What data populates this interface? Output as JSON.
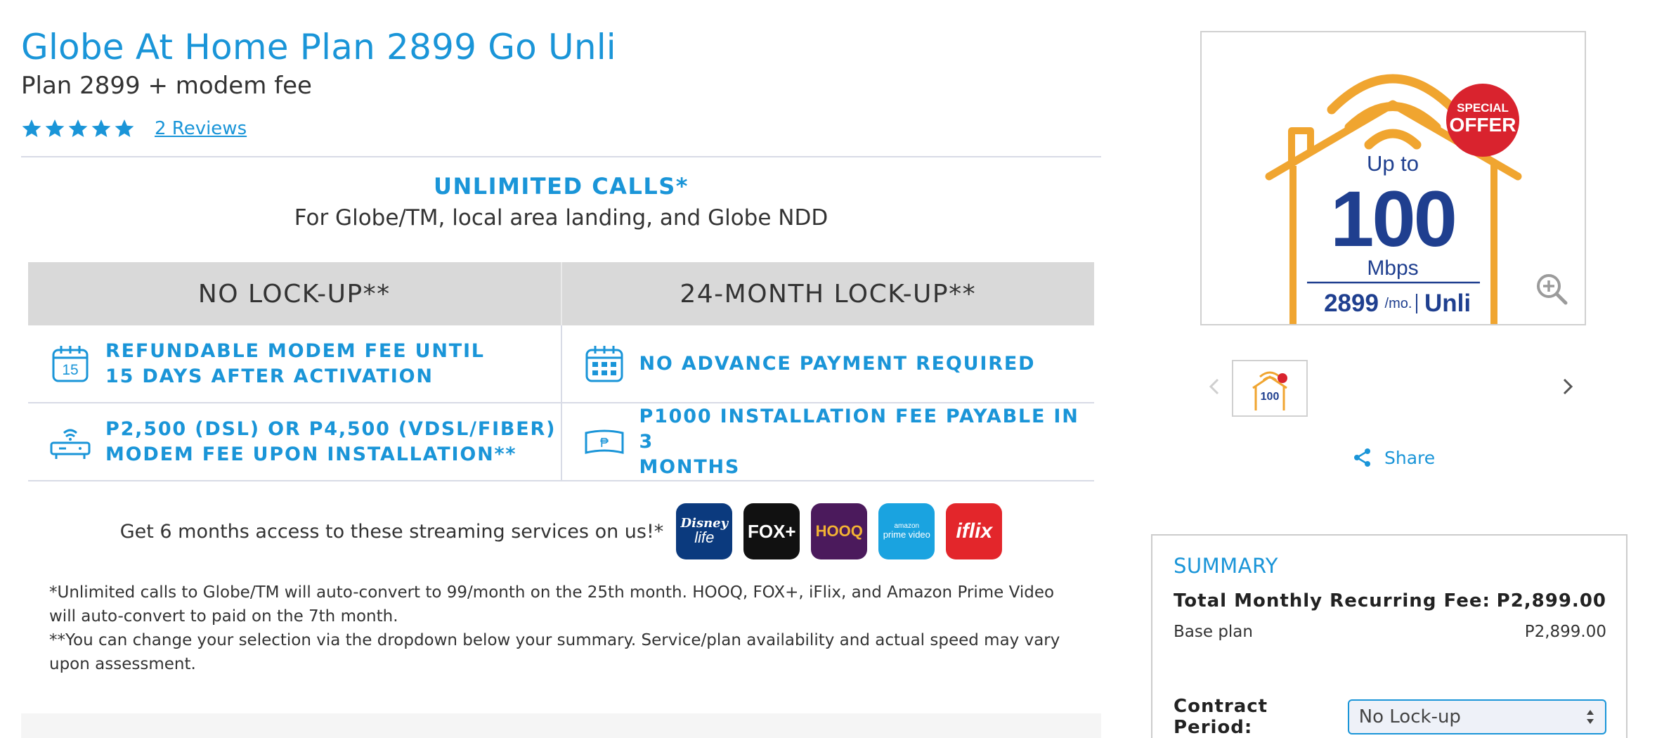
{
  "product": {
    "title": "Globe At Home Plan 2899 Go Unli",
    "subtitle": "Plan 2899 + modem fee",
    "rating_stars": 5,
    "reviews_label": "2 Reviews"
  },
  "calls": {
    "title": "UNLIMITED CALLS*",
    "subtitle": "For Globe/TM, local area landing, and Globe NDD"
  },
  "lockup_table": {
    "headers": [
      "NO LOCK-UP**",
      "24-MONTH LOCK-UP**"
    ],
    "rows": [
      [
        {
          "icon": "calendar-15-icon",
          "text": "REFUNDABLE MODEM FEE UNTIL\n15 DAYS AFTER ACTIVATION"
        },
        {
          "icon": "calendar-grid-icon",
          "text": "NO ADVANCE PAYMENT REQUIRED"
        }
      ],
      [
        {
          "icon": "modem-router-icon",
          "text": "P2,500 (DSL) OR P4,500 (VDSL/FIBER)\nMODEM FEE UPON INSTALLATION**"
        },
        {
          "icon": "peso-bill-icon",
          "text": "P1000 INSTALLATION FEE PAYABLE IN 3\nMONTHS"
        }
      ]
    ]
  },
  "streaming": {
    "text": "Get 6 months access to these streaming services on us!*",
    "apps": [
      {
        "name": "disney-life-logo",
        "line1": "Disney",
        "line2": "life",
        "color": "#0b3a7e"
      },
      {
        "name": "fox-plus-logo",
        "line1": "FOX+",
        "line2": "",
        "color": "#111111"
      },
      {
        "name": "hooq-logo",
        "line1": "HOOQ",
        "line2": "",
        "color": "#4b1a5c"
      },
      {
        "name": "amazon-prime-video-logo",
        "line1": "amazon",
        "line2": "prime video",
        "color": "#1aa3e0"
      },
      {
        "name": "iflix-logo",
        "line1": "iflix",
        "line2": "",
        "color": "#e3262b"
      }
    ]
  },
  "fine_print": {
    "line1": "*Unlimited calls to Globe/TM will auto-convert to 99/month on the 25th month. HOOQ, FOX+, iFlix, and Amazon Prime Video will auto-convert to paid on the 7th month.",
    "line2": "**You can change your selection via the dropdown below your summary. Service/plan availability and actual speed may vary upon assessment."
  },
  "hero_image": {
    "up_to": "Up to",
    "speed": "100",
    "unit": "Mbps",
    "price": "2899",
    "per": "/mo.",
    "plan": "Unli",
    "badge_line1": "SPECIAL",
    "badge_line2": "OFFER",
    "thumb_speed": "100"
  },
  "share": {
    "label": "Share"
  },
  "summary": {
    "title": "SUMMARY",
    "total_label": "Total Monthly Recurring Fee:",
    "total_value": "P2,899.00",
    "base_label": "Base plan",
    "base_value": "P2,899.00",
    "contract_label": "Contract Period:",
    "contract_selected": "No Lock-up"
  },
  "colors": {
    "accent": "#1a95d8",
    "house_orange": "#f0a530",
    "speed_navy": "#1f3f8f",
    "badge_red": "#d9232e"
  }
}
